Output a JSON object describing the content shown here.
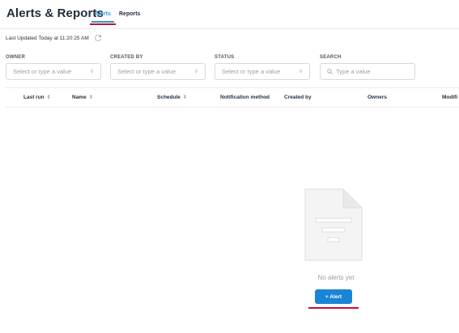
{
  "header": {
    "title": "Alerts & Reports",
    "tabs": [
      {
        "label": "Alerts",
        "active": true
      },
      {
        "label": "Reports",
        "active": false
      }
    ]
  },
  "status": {
    "last_updated": "Last Updated Today at 11:20:25 AM"
  },
  "filters": [
    {
      "label": "OWNER",
      "placeholder": "Select or type a value"
    },
    {
      "label": "CREATED BY",
      "placeholder": "Select or type a value"
    },
    {
      "label": "STATUS",
      "placeholder": "Select or type a value"
    },
    {
      "label": "SEARCH",
      "placeholder": "Type a value"
    }
  ],
  "table": {
    "columns": [
      {
        "label": "Last run",
        "sortable": true
      },
      {
        "label": "Name",
        "sortable": true
      },
      {
        "label": "Schedule",
        "sortable": true
      },
      {
        "label": "Notification method",
        "sortable": false
      },
      {
        "label": "Created by",
        "sortable": false
      },
      {
        "label": "Owners",
        "sortable": false
      },
      {
        "label": "Modifi",
        "sortable": false
      }
    ]
  },
  "empty_state": {
    "message": "No alerts yet",
    "button_label": "+ Alert"
  },
  "colors": {
    "accent": "#2a9ac9",
    "primary_button": "#1a85d6",
    "highlight_underline": "#c8102e"
  }
}
